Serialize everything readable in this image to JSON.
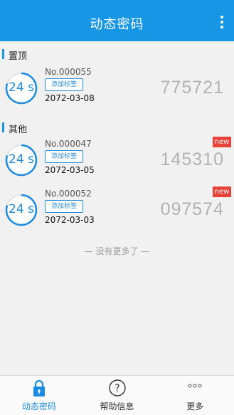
{
  "header": {
    "title": "动态密码",
    "menu_icon": "more-vert-icon"
  },
  "sections": [
    {
      "label": "置顶",
      "items": [
        {
          "number": "No.000055",
          "tag_button": "添加标签",
          "date": "2072-03-08",
          "code": "775721",
          "timer": "24 s",
          "countdown_fraction": 0.8,
          "badge": ""
        }
      ]
    },
    {
      "label": "其他",
      "items": [
        {
          "number": "No.000047",
          "tag_button": "添加标签",
          "date": "2072-03-05",
          "code": "145310",
          "timer": "24 s",
          "countdown_fraction": 0.8,
          "badge": "new"
        },
        {
          "number": "No.000052",
          "tag_button": "添加标签",
          "date": "2072-03-03",
          "code": "097574",
          "timer": "24 s",
          "countdown_fraction": 0.8,
          "badge": "new"
        }
      ]
    }
  ],
  "footer_note": "— 没有更多了 —",
  "tabs": [
    {
      "label": "动态密码",
      "icon": "lock-icon",
      "active": true
    },
    {
      "label": "帮助信息",
      "icon": "question-circle-icon",
      "active": false
    },
    {
      "label": "更多",
      "icon": "more-horiz-icon",
      "active": false
    }
  ],
  "colors": {
    "primary": "#1796e6",
    "badge": "#e8423b",
    "code_text": "#b2b2b2"
  }
}
